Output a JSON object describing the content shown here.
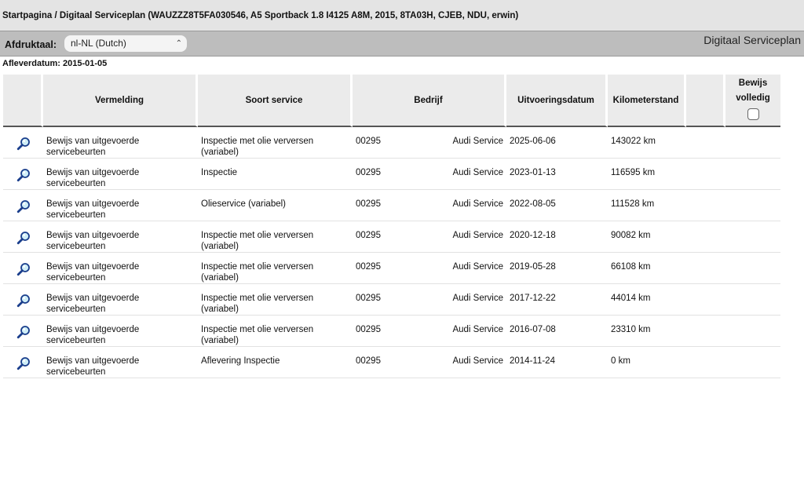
{
  "breadcrumb": "Startpagina / Digitaal Serviceplan (WAUZZZ8T5FA030546, A5 Sportback 1.8 I4125 A8M, 2015, 8TA03H, CJEB, NDU, erwin)",
  "language": {
    "label": "Afdruktaal:",
    "selected": "nl-NL (Dutch)"
  },
  "page_title": "Digitaal Serviceplan",
  "delivery_date": "Afleverdatum: 2015-01-05",
  "table": {
    "headers": {
      "vermelding": "Vermelding",
      "soort": "Soort service",
      "bedrijf": "Bedrijf",
      "datum": "Uitvoeringsdatum",
      "km": "Kilometerstand",
      "bewijs": "Bewijs volledig"
    },
    "rows": [
      {
        "vermelding": "Bewijs van uitgevoerde servicebeurten",
        "soort": "Inspectie met olie verversen (variabel)",
        "code": "00295",
        "bedrijf": "Audi Service",
        "datum": "2025-06-06",
        "km": "143022 km"
      },
      {
        "vermelding": "Bewijs van uitgevoerde servicebeurten",
        "soort": "Inspectie",
        "code": "00295",
        "bedrijf": "Audi Service",
        "datum": "2023-01-13",
        "km": "116595 km"
      },
      {
        "vermelding": "Bewijs van uitgevoerde servicebeurten",
        "soort": "Olieservice (variabel)",
        "code": "00295",
        "bedrijf": "Audi Service",
        "datum": "2022-08-05",
        "km": "111528 km"
      },
      {
        "vermelding": "Bewijs van uitgevoerde servicebeurten",
        "soort": "Inspectie met olie verversen (variabel)",
        "code": "00295",
        "bedrijf": "Audi Service",
        "datum": "2020-12-18",
        "km": "90082 km"
      },
      {
        "vermelding": "Bewijs van uitgevoerde servicebeurten",
        "soort": "Inspectie met olie verversen (variabel)",
        "code": "00295",
        "bedrijf": "Audi Service",
        "datum": "2019-05-28",
        "km": "66108 km"
      },
      {
        "vermelding": "Bewijs van uitgevoerde servicebeurten",
        "soort": "Inspectie met olie verversen (variabel)",
        "code": "00295",
        "bedrijf": "Audi Service",
        "datum": "2017-12-22",
        "km": "44014 km"
      },
      {
        "vermelding": "Bewijs van uitgevoerde servicebeurten",
        "soort": "Inspectie met olie verversen (variabel)",
        "code": "00295",
        "bedrijf": "Audi Service",
        "datum": "2016-07-08",
        "km": "23310 km"
      },
      {
        "vermelding": "Bewijs van uitgevoerde servicebeurten",
        "soort": "Aflevering Inspectie",
        "code": "00295",
        "bedrijf": "Audi Service",
        "datum": "2014-11-24",
        "km": "0 km"
      }
    ]
  },
  "icons": {
    "row_action": "magnifier-icon",
    "select": "chevron-updown-icon"
  }
}
